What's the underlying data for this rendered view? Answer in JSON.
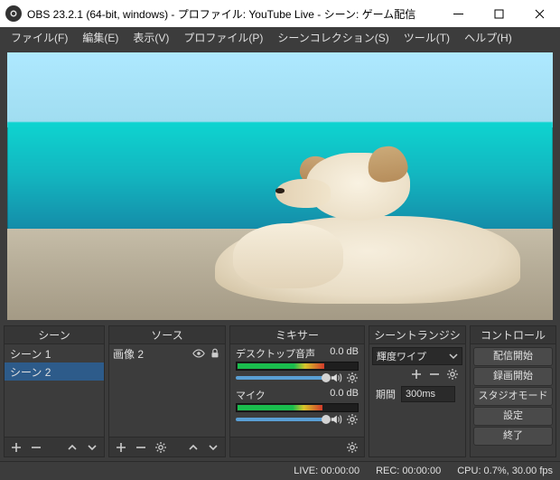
{
  "titlebar": {
    "title": "OBS 23.2.1 (64-bit, windows) - プロファイル: YouTube Live - シーン: ゲーム配信"
  },
  "menu": {
    "file": "ファイル(F)",
    "edit": "編集(E)",
    "view": "表示(V)",
    "profile": "プロファイル(P)",
    "scene_col": "シーンコレクション(S)",
    "tools": "ツール(T)",
    "help": "ヘルプ(H)"
  },
  "panels": {
    "scenes": {
      "header": "シーン",
      "items": [
        "シーン 1",
        "シーン 2"
      ],
      "selected": 1
    },
    "sources": {
      "header": "ソース",
      "items": [
        {
          "label": "画像 2"
        }
      ]
    },
    "mixer": {
      "header": "ミキサー",
      "tracks": [
        {
          "name": "デスクトップ音声",
          "db": "0.0 dB",
          "volume_pct": 100,
          "level_pct": 72
        },
        {
          "name": "マイク",
          "db": "0.0 dB",
          "volume_pct": 100,
          "level_pct": 70
        }
      ]
    },
    "transitions": {
      "header": "シーントランジション",
      "selected": "輝度ワイプ",
      "duration_label": "期間",
      "duration_value": "300ms"
    },
    "controls": {
      "header": "コントロール",
      "buttons": {
        "stream": "配信開始",
        "record": "録画開始",
        "studio": "スタジオモード",
        "settings": "設定",
        "exit": "終了"
      }
    }
  },
  "statusbar": {
    "live": "LIVE: 00:00:00",
    "rec": "REC: 00:00:00",
    "cpu": "CPU: 0.7%, 30.00 fps"
  },
  "colors": {
    "accent": "#2d5b8a"
  }
}
